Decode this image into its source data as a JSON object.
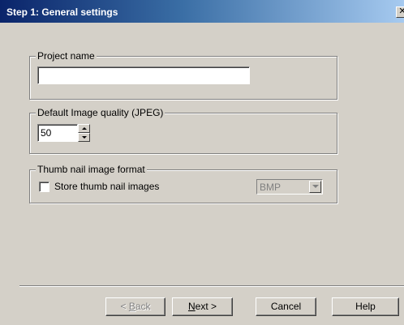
{
  "window": {
    "title": "Step 1: General settings",
    "close_glyph": "✕"
  },
  "project_group": {
    "legend": "Project name",
    "value": "",
    "placeholder": ""
  },
  "quality_group": {
    "legend": "Default Image quality (JPEG)",
    "value": "50"
  },
  "thumb_group": {
    "legend": "Thumb nail image format",
    "checkbox_label": "Store thumb nail images",
    "checked": false,
    "format_value": "BMP",
    "format_enabled": false
  },
  "buttons": {
    "back_prefix": "< ",
    "back_mnemonic": "B",
    "back_rest": "ack",
    "back_enabled": false,
    "next_mnemonic": "N",
    "next_rest": "ext >",
    "cancel": "Cancel",
    "help": "Help"
  },
  "icons": {
    "close": "close-icon",
    "spin_up": "spin-up-icon",
    "spin_down": "spin-down-icon",
    "dropdown": "chevron-down-icon"
  }
}
